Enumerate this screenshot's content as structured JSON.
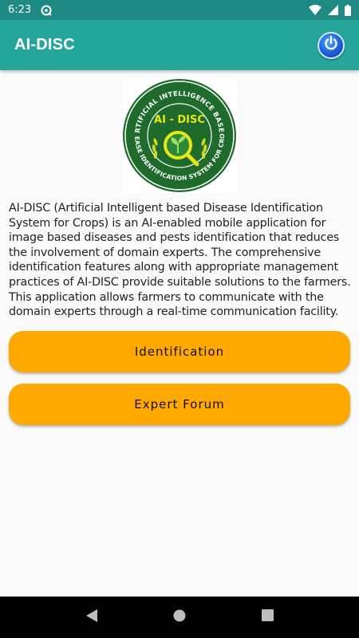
{
  "status_bar": {
    "time": "6:23",
    "icons": [
      "sync-icon",
      "wifi-icon",
      "signal-icon",
      "battery-icon"
    ]
  },
  "app_bar": {
    "title": "AI-DISC",
    "power_icon": "power-icon"
  },
  "logo": {
    "top_arc": "ARTIFICIAL INTELLIGENCE BASED",
    "center_text": "AI - DISC",
    "bottom_arc": "DISEASE IDENTIFICATION SYSTEM FOR CROPS"
  },
  "description": "AI-DISC (Artificial Intelligent based Disease Identification System for Crops) is an AI-enabled mobile application for image based diseases and pests identification that reduces the involvement of domain experts. The comprehensive identification features along with appropriate management practices of AI-DISC provide suitable solutions to the farmers. This application allows farmers to communicate with the domain experts through a real-time communication facility.",
  "buttons": {
    "identification": "Identification",
    "expert_forum": "Expert Forum"
  },
  "nav_bar": {
    "icons": [
      "back-icon",
      "home-icon",
      "recents-icon"
    ]
  },
  "colors": {
    "status_bar": "#1f8a84",
    "app_bar": "#26a59a",
    "button": "#ffa800",
    "logo_green": "#1e6b2c",
    "logo_yellow": "#e6e619"
  }
}
